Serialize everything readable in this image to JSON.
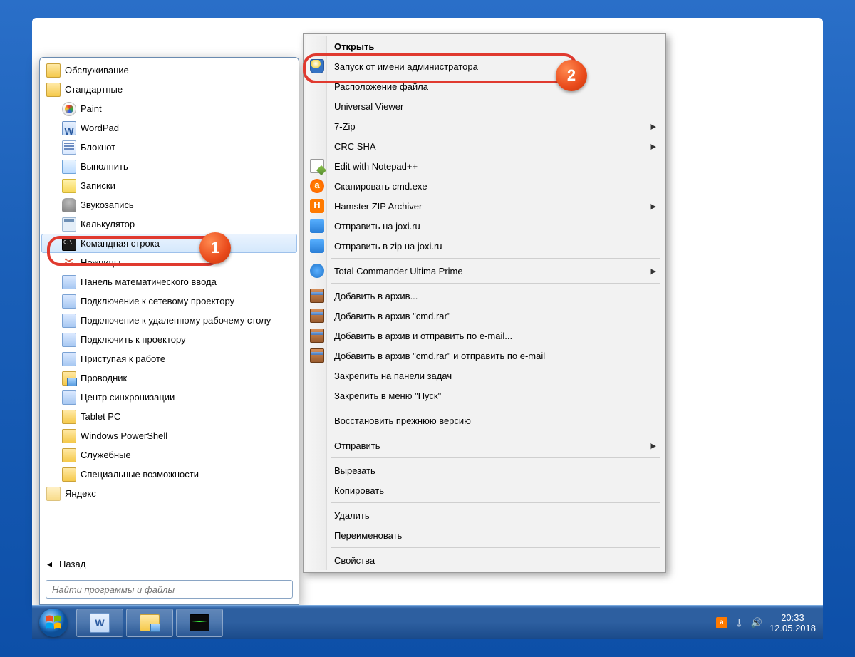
{
  "desktop": {},
  "taskbar": {
    "tray_time": "20:33",
    "tray_date": "12.05.2018"
  },
  "start_menu": {
    "items": [
      {
        "icon": "folder",
        "indent": 0,
        "label": "Обслуживание"
      },
      {
        "icon": "folder",
        "indent": 0,
        "label": "Стандартные"
      },
      {
        "icon": "paint",
        "indent": 1,
        "label": "Paint"
      },
      {
        "icon": "word",
        "indent": 1,
        "label": "WordPad"
      },
      {
        "icon": "note",
        "indent": 1,
        "label": "Блокнот"
      },
      {
        "icon": "run",
        "indent": 1,
        "label": "Выполнить"
      },
      {
        "icon": "sticky",
        "indent": 1,
        "label": "Записки"
      },
      {
        "icon": "mic",
        "indent": 1,
        "label": "Звукозапись"
      },
      {
        "icon": "calc",
        "indent": 1,
        "label": "Калькулятор"
      },
      {
        "icon": "cmd",
        "indent": 1,
        "label": "Командная строка",
        "hover": true
      },
      {
        "icon": "scissors",
        "indent": 1,
        "label": "Ножницы"
      },
      {
        "icon": "app",
        "indent": 1,
        "label": "Панель математического ввода"
      },
      {
        "icon": "app",
        "indent": 1,
        "label": "Подключение к сетевому проектору"
      },
      {
        "icon": "app",
        "indent": 1,
        "label": "Подключение к удаленному рабочему столу"
      },
      {
        "icon": "app",
        "indent": 1,
        "label": "Подключить к проектору"
      },
      {
        "icon": "app",
        "indent": 1,
        "label": "Приступая к работе"
      },
      {
        "icon": "explorer",
        "indent": 1,
        "label": "Проводник"
      },
      {
        "icon": "app",
        "indent": 1,
        "label": "Центр синхронизации"
      },
      {
        "icon": "folder",
        "indent": 1,
        "label": "Tablet PC"
      },
      {
        "icon": "folder",
        "indent": 1,
        "label": "Windows PowerShell"
      },
      {
        "icon": "folder",
        "indent": 1,
        "label": "Служебные"
      },
      {
        "icon": "folder",
        "indent": 1,
        "label": "Специальные возможности"
      },
      {
        "icon": "folder-faded",
        "indent": 0,
        "label": "Яндекс"
      }
    ],
    "back_label": "Назад",
    "search_placeholder": "Найти программы и файлы"
  },
  "context_menu": {
    "items": [
      {
        "label": "Открыть",
        "bold": true
      },
      {
        "label": "Запуск от имени администратора",
        "icon": "shield",
        "highlighted": true
      },
      {
        "label": "Расположение файла"
      },
      {
        "label": "Universal Viewer"
      },
      {
        "label": "7-Zip",
        "submenu": true
      },
      {
        "label": "CRC SHA",
        "submenu": true
      },
      {
        "label": "Edit with Notepad++",
        "icon": "edit"
      },
      {
        "label": "Сканировать cmd.exe",
        "icon": "avast"
      },
      {
        "label": "Hamster ZIP Archiver",
        "icon": "ham",
        "submenu": true
      },
      {
        "label": "Отправить на joxi.ru",
        "icon": "joxi"
      },
      {
        "label": "Отправить в zip на joxi.ru",
        "icon": "joxi"
      },
      {
        "sep": true
      },
      {
        "label": "Total Commander Ultima Prime",
        "icon": "tc",
        "submenu": true
      },
      {
        "sep": true
      },
      {
        "label": "Добавить в архив...",
        "icon": "rar"
      },
      {
        "label": "Добавить в архив \"cmd.rar\"",
        "icon": "rar"
      },
      {
        "label": "Добавить в архив и отправить по e-mail...",
        "icon": "rar"
      },
      {
        "label": "Добавить в архив \"cmd.rar\" и отправить по e-mail",
        "icon": "rar"
      },
      {
        "label": "Закрепить на панели задач"
      },
      {
        "label": "Закрепить в меню \"Пуск\""
      },
      {
        "sep": true
      },
      {
        "label": "Восстановить прежнюю версию"
      },
      {
        "sep": true
      },
      {
        "label": "Отправить",
        "submenu": true
      },
      {
        "sep": true
      },
      {
        "label": "Вырезать"
      },
      {
        "label": "Копировать"
      },
      {
        "sep": true
      },
      {
        "label": "Удалить"
      },
      {
        "label": "Переименовать"
      },
      {
        "sep": true
      },
      {
        "label": "Свойства"
      }
    ]
  },
  "annotations": {
    "badge1": "1",
    "badge2": "2"
  }
}
